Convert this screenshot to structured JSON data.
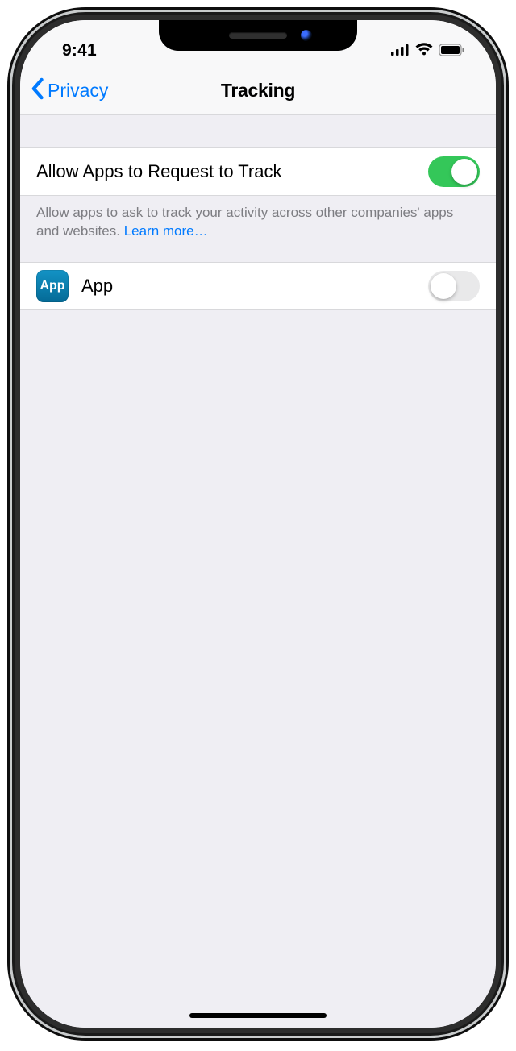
{
  "status": {
    "time": "9:41"
  },
  "nav": {
    "back_label": "Privacy",
    "title": "Tracking"
  },
  "settings": {
    "allow_label": "Allow Apps to Request to Track",
    "allow_on": true,
    "footer_text": "Allow apps to ask to track your activity across other companies' apps and websites. ",
    "learn_more": "Learn more…"
  },
  "apps": [
    {
      "icon_text": "App",
      "name": "App",
      "tracking_on": false
    }
  ]
}
